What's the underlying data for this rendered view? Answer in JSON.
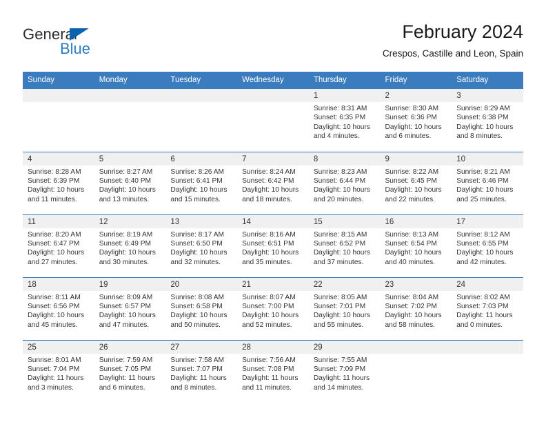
{
  "brand": {
    "name_part1": "General",
    "name_part2": "Blue",
    "accent_color": "#2a7dc4",
    "triangle_color": "#0b62b0"
  },
  "header": {
    "title": "February 2024",
    "subtitle": "Crespos, Castille and Leon, Spain"
  },
  "calendar": {
    "header_bg": "#3a7cbe",
    "daynum_bg": "#f0f0f0",
    "weekdays": [
      "Sunday",
      "Monday",
      "Tuesday",
      "Wednesday",
      "Thursday",
      "Friday",
      "Saturday"
    ],
    "weeks": [
      [
        {
          "day": "",
          "sunrise": "",
          "sunset": "",
          "daylight1": "",
          "daylight2": ""
        },
        {
          "day": "",
          "sunrise": "",
          "sunset": "",
          "daylight1": "",
          "daylight2": ""
        },
        {
          "day": "",
          "sunrise": "",
          "sunset": "",
          "daylight1": "",
          "daylight2": ""
        },
        {
          "day": "",
          "sunrise": "",
          "sunset": "",
          "daylight1": "",
          "daylight2": ""
        },
        {
          "day": "1",
          "sunrise": "Sunrise: 8:31 AM",
          "sunset": "Sunset: 6:35 PM",
          "daylight1": "Daylight: 10 hours",
          "daylight2": "and 4 minutes."
        },
        {
          "day": "2",
          "sunrise": "Sunrise: 8:30 AM",
          "sunset": "Sunset: 6:36 PM",
          "daylight1": "Daylight: 10 hours",
          "daylight2": "and 6 minutes."
        },
        {
          "day": "3",
          "sunrise": "Sunrise: 8:29 AM",
          "sunset": "Sunset: 6:38 PM",
          "daylight1": "Daylight: 10 hours",
          "daylight2": "and 8 minutes."
        }
      ],
      [
        {
          "day": "4",
          "sunrise": "Sunrise: 8:28 AM",
          "sunset": "Sunset: 6:39 PM",
          "daylight1": "Daylight: 10 hours",
          "daylight2": "and 11 minutes."
        },
        {
          "day": "5",
          "sunrise": "Sunrise: 8:27 AM",
          "sunset": "Sunset: 6:40 PM",
          "daylight1": "Daylight: 10 hours",
          "daylight2": "and 13 minutes."
        },
        {
          "day": "6",
          "sunrise": "Sunrise: 8:26 AM",
          "sunset": "Sunset: 6:41 PM",
          "daylight1": "Daylight: 10 hours",
          "daylight2": "and 15 minutes."
        },
        {
          "day": "7",
          "sunrise": "Sunrise: 8:24 AM",
          "sunset": "Sunset: 6:42 PM",
          "daylight1": "Daylight: 10 hours",
          "daylight2": "and 18 minutes."
        },
        {
          "day": "8",
          "sunrise": "Sunrise: 8:23 AM",
          "sunset": "Sunset: 6:44 PM",
          "daylight1": "Daylight: 10 hours",
          "daylight2": "and 20 minutes."
        },
        {
          "day": "9",
          "sunrise": "Sunrise: 8:22 AM",
          "sunset": "Sunset: 6:45 PM",
          "daylight1": "Daylight: 10 hours",
          "daylight2": "and 22 minutes."
        },
        {
          "day": "10",
          "sunrise": "Sunrise: 8:21 AM",
          "sunset": "Sunset: 6:46 PM",
          "daylight1": "Daylight: 10 hours",
          "daylight2": "and 25 minutes."
        }
      ],
      [
        {
          "day": "11",
          "sunrise": "Sunrise: 8:20 AM",
          "sunset": "Sunset: 6:47 PM",
          "daylight1": "Daylight: 10 hours",
          "daylight2": "and 27 minutes."
        },
        {
          "day": "12",
          "sunrise": "Sunrise: 8:19 AM",
          "sunset": "Sunset: 6:49 PM",
          "daylight1": "Daylight: 10 hours",
          "daylight2": "and 30 minutes."
        },
        {
          "day": "13",
          "sunrise": "Sunrise: 8:17 AM",
          "sunset": "Sunset: 6:50 PM",
          "daylight1": "Daylight: 10 hours",
          "daylight2": "and 32 minutes."
        },
        {
          "day": "14",
          "sunrise": "Sunrise: 8:16 AM",
          "sunset": "Sunset: 6:51 PM",
          "daylight1": "Daylight: 10 hours",
          "daylight2": "and 35 minutes."
        },
        {
          "day": "15",
          "sunrise": "Sunrise: 8:15 AM",
          "sunset": "Sunset: 6:52 PM",
          "daylight1": "Daylight: 10 hours",
          "daylight2": "and 37 minutes."
        },
        {
          "day": "16",
          "sunrise": "Sunrise: 8:13 AM",
          "sunset": "Sunset: 6:54 PM",
          "daylight1": "Daylight: 10 hours",
          "daylight2": "and 40 minutes."
        },
        {
          "day": "17",
          "sunrise": "Sunrise: 8:12 AM",
          "sunset": "Sunset: 6:55 PM",
          "daylight1": "Daylight: 10 hours",
          "daylight2": "and 42 minutes."
        }
      ],
      [
        {
          "day": "18",
          "sunrise": "Sunrise: 8:11 AM",
          "sunset": "Sunset: 6:56 PM",
          "daylight1": "Daylight: 10 hours",
          "daylight2": "and 45 minutes."
        },
        {
          "day": "19",
          "sunrise": "Sunrise: 8:09 AM",
          "sunset": "Sunset: 6:57 PM",
          "daylight1": "Daylight: 10 hours",
          "daylight2": "and 47 minutes."
        },
        {
          "day": "20",
          "sunrise": "Sunrise: 8:08 AM",
          "sunset": "Sunset: 6:58 PM",
          "daylight1": "Daylight: 10 hours",
          "daylight2": "and 50 minutes."
        },
        {
          "day": "21",
          "sunrise": "Sunrise: 8:07 AM",
          "sunset": "Sunset: 7:00 PM",
          "daylight1": "Daylight: 10 hours",
          "daylight2": "and 52 minutes."
        },
        {
          "day": "22",
          "sunrise": "Sunrise: 8:05 AM",
          "sunset": "Sunset: 7:01 PM",
          "daylight1": "Daylight: 10 hours",
          "daylight2": "and 55 minutes."
        },
        {
          "day": "23",
          "sunrise": "Sunrise: 8:04 AM",
          "sunset": "Sunset: 7:02 PM",
          "daylight1": "Daylight: 10 hours",
          "daylight2": "and 58 minutes."
        },
        {
          "day": "24",
          "sunrise": "Sunrise: 8:02 AM",
          "sunset": "Sunset: 7:03 PM",
          "daylight1": "Daylight: 11 hours",
          "daylight2": "and 0 minutes."
        }
      ],
      [
        {
          "day": "25",
          "sunrise": "Sunrise: 8:01 AM",
          "sunset": "Sunset: 7:04 PM",
          "daylight1": "Daylight: 11 hours",
          "daylight2": "and 3 minutes."
        },
        {
          "day": "26",
          "sunrise": "Sunrise: 7:59 AM",
          "sunset": "Sunset: 7:05 PM",
          "daylight1": "Daylight: 11 hours",
          "daylight2": "and 6 minutes."
        },
        {
          "day": "27",
          "sunrise": "Sunrise: 7:58 AM",
          "sunset": "Sunset: 7:07 PM",
          "daylight1": "Daylight: 11 hours",
          "daylight2": "and 8 minutes."
        },
        {
          "day": "28",
          "sunrise": "Sunrise: 7:56 AM",
          "sunset": "Sunset: 7:08 PM",
          "daylight1": "Daylight: 11 hours",
          "daylight2": "and 11 minutes."
        },
        {
          "day": "29",
          "sunrise": "Sunrise: 7:55 AM",
          "sunset": "Sunset: 7:09 PM",
          "daylight1": "Daylight: 11 hours",
          "daylight2": "and 14 minutes."
        },
        {
          "day": "",
          "sunrise": "",
          "sunset": "",
          "daylight1": "",
          "daylight2": ""
        },
        {
          "day": "",
          "sunrise": "",
          "sunset": "",
          "daylight1": "",
          "daylight2": ""
        }
      ]
    ]
  }
}
